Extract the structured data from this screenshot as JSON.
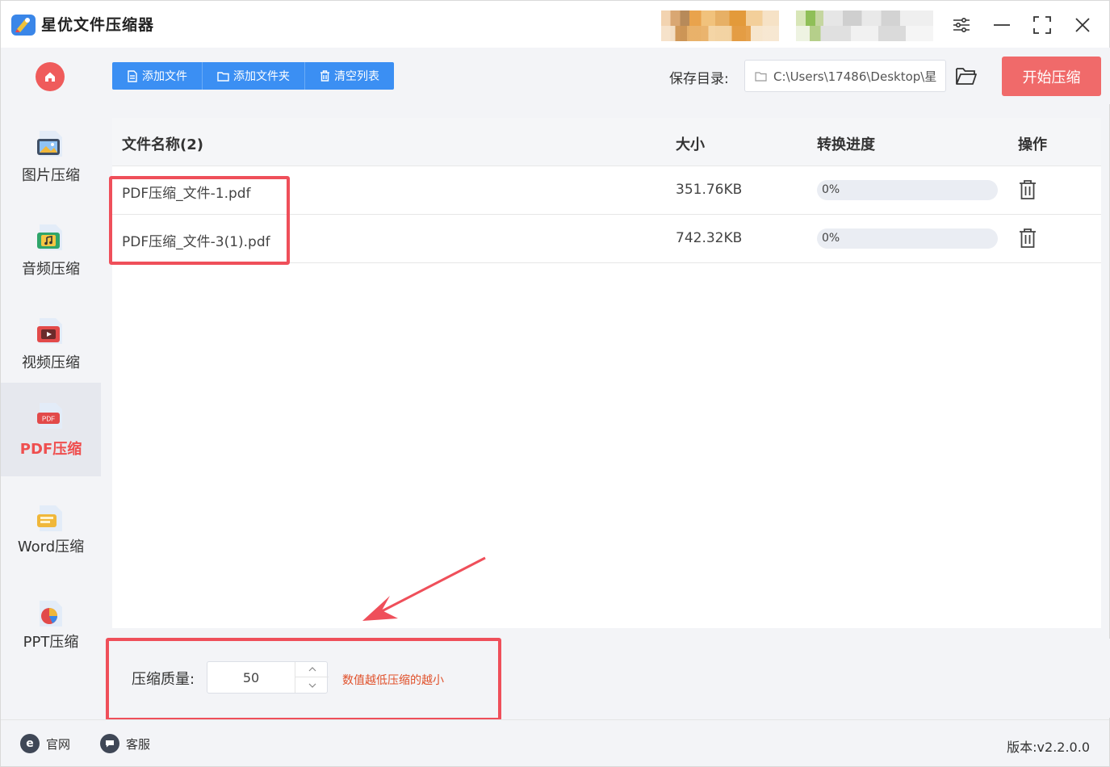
{
  "app": {
    "title": "星优文件压缩器"
  },
  "sidebar": {
    "items": [
      {
        "label": "图片压缩",
        "icon": "image-icon",
        "active": false
      },
      {
        "label": "音频压缩",
        "icon": "audio-icon",
        "active": false
      },
      {
        "label": "视频压缩",
        "icon": "video-icon",
        "active": false
      },
      {
        "label": "PDF压缩",
        "icon": "pdf-icon",
        "active": true
      },
      {
        "label": "Word压缩",
        "icon": "word-icon",
        "active": false
      },
      {
        "label": "PPT压缩",
        "icon": "ppt-icon",
        "active": false
      }
    ]
  },
  "toolbar": {
    "add_file": "添加文件",
    "add_folder": "添加文件夹",
    "clear_list": "清空列表",
    "save_label": "保存目录:",
    "save_path": "C:\\Users\\17486\\Desktop\\星",
    "start": "开始压缩"
  },
  "table": {
    "headers": {
      "name": "文件名称(2)",
      "size": "大小",
      "progress": "转换进度",
      "action": "操作"
    },
    "rows": [
      {
        "name": "PDF压缩_文件-1.pdf",
        "size": "351.76KB",
        "progress_text": "0%",
        "progress": 0
      },
      {
        "name": "PDF压缩_文件-3(1).pdf",
        "size": "742.32KB",
        "progress_text": "0%",
        "progress": 0
      }
    ]
  },
  "settings": {
    "quality_label": "压缩质量:",
    "quality_value": "50",
    "hint": "数值越低压缩的越小"
  },
  "statusbar": {
    "website": "官网",
    "service": "客服",
    "version": "版本:v2.2.0.0"
  },
  "colors": {
    "primary": "#3b8ff3",
    "accent": "#f06a6a",
    "active_nav": "#ef4f4f",
    "hint": "#e0502a"
  }
}
